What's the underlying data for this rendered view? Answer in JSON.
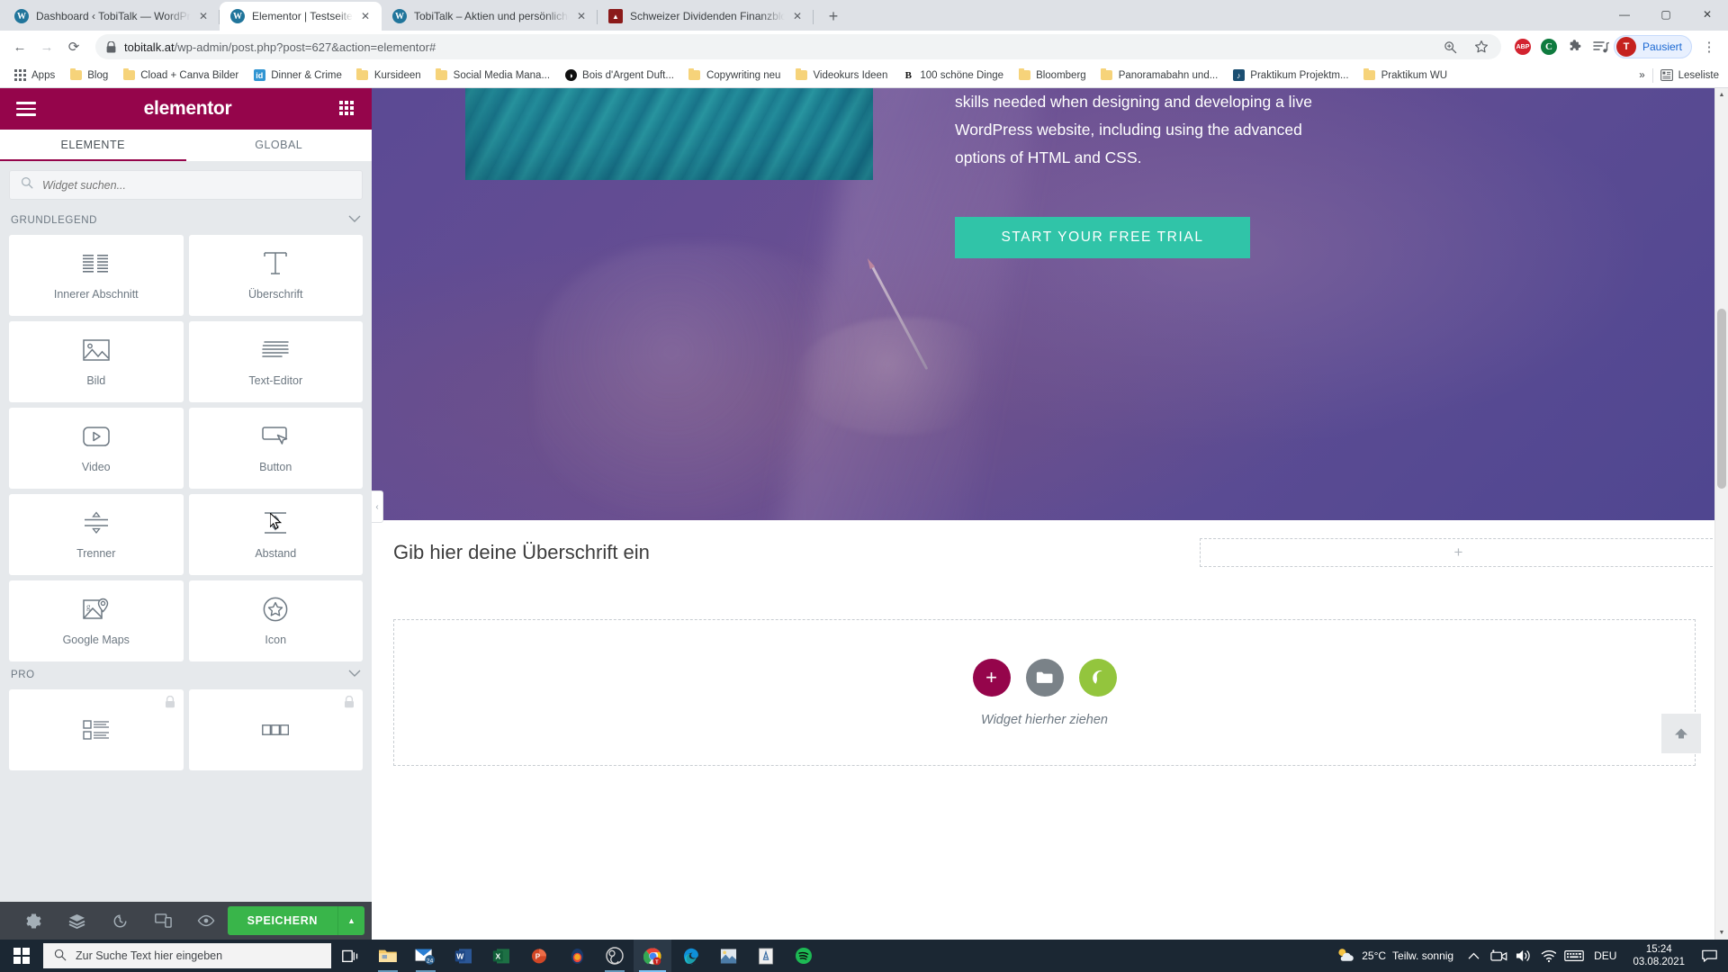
{
  "browser": {
    "tabs": [
      {
        "title": "Dashboard ‹ TobiTalk — WordPre",
        "favicon": "wordpress-icon",
        "active": false
      },
      {
        "title": "Elementor | Testseite",
        "favicon": "wordpress-icon",
        "active": true
      },
      {
        "title": "TobiTalk – Aktien und persönliche",
        "favicon": "wordpress-icon",
        "active": false
      },
      {
        "title": "Schweizer Dividenden Finanzblog",
        "favicon": "site-icon",
        "active": false
      }
    ],
    "new_tab_label": "+",
    "window_controls": {
      "minimize": "—",
      "maximize": "▢",
      "close": "✕"
    },
    "nav": {
      "back": "←",
      "forward": "→",
      "reload": "⟳"
    },
    "omnibox": {
      "host": "tobitalk.at",
      "path": "/wp-admin/post.php?post=627&action=elementor#",
      "lock_icon": "lock-icon",
      "zoom_icon": "zoom-icon",
      "bookmark_icon": "star-icon"
    },
    "extensions": [
      {
        "name": "adblock-plus-icon",
        "label": "ABP"
      },
      {
        "name": "ghostery-icon",
        "label": "C"
      },
      {
        "name": "extensions-puzzle-icon",
        "label": "🧩"
      },
      {
        "name": "reading-list-icon",
        "label": "≡♪"
      }
    ],
    "profile": {
      "initial": "T",
      "label": "Pausiert"
    },
    "menu_icon": "kebab-menu-icon",
    "bookmarks": [
      {
        "label": "Apps",
        "icon": "apps-grid-icon"
      },
      {
        "label": "Blog",
        "icon": "folder-icon"
      },
      {
        "label": "Cload + Canva Bilder",
        "icon": "folder-icon"
      },
      {
        "label": "Dinner & Crime",
        "icon": "id-icon"
      },
      {
        "label": "Kursideen",
        "icon": "folder-icon"
      },
      {
        "label": "Social Media Mana...",
        "icon": "folder-icon"
      },
      {
        "label": "Bois d'Argent Duft...",
        "icon": "dark-circle-icon"
      },
      {
        "label": "Copywriting neu",
        "icon": "folder-icon"
      },
      {
        "label": "Videokurs Ideen",
        "icon": "folder-icon"
      },
      {
        "label": "100 schöne Dinge",
        "icon": "letter-b-icon"
      },
      {
        "label": "Bloomberg",
        "icon": "folder-icon"
      },
      {
        "label": "Panoramabahn und...",
        "icon": "folder-icon"
      },
      {
        "label": "Praktikum Projektm...",
        "icon": "blue-square-icon"
      },
      {
        "label": "Praktikum WU",
        "icon": "folder-icon"
      }
    ],
    "bookmarks_overflow": "»",
    "reading_list": {
      "label": "Leseliste",
      "icon": "reading-list-panel-icon"
    }
  },
  "elementor": {
    "brand": "elementor",
    "menu_icon": "hamburger-menu-icon",
    "grid_icon": "widgets-grid-icon",
    "tabs": [
      {
        "label": "ELEMENTE",
        "active": true
      },
      {
        "label": "GLOBAL",
        "active": false
      }
    ],
    "search": {
      "placeholder": "Widget suchen...",
      "value": "",
      "icon": "search-icon"
    },
    "categories": [
      {
        "name": "GRUNDLEGEND",
        "collapse_icon": "chevron-down-icon",
        "widgets": [
          {
            "label": "Innerer Abschnitt",
            "icon": "inner-section-icon",
            "locked": false
          },
          {
            "label": "Überschrift",
            "icon": "heading-icon",
            "locked": false
          },
          {
            "label": "Bild",
            "icon": "image-icon",
            "locked": false
          },
          {
            "label": "Text-Editor",
            "icon": "text-editor-icon",
            "locked": false
          },
          {
            "label": "Video",
            "icon": "video-icon",
            "locked": false
          },
          {
            "label": "Button",
            "icon": "button-icon",
            "locked": false
          },
          {
            "label": "Trenner",
            "icon": "divider-icon",
            "locked": false
          },
          {
            "label": "Abstand",
            "icon": "spacer-icon",
            "locked": false
          },
          {
            "label": "Google Maps",
            "icon": "google-maps-icon",
            "locked": false
          },
          {
            "label": "Icon",
            "icon": "star-icon",
            "locked": false
          }
        ]
      },
      {
        "name": "PRO",
        "collapse_icon": "chevron-down-icon",
        "widgets": [
          {
            "label": "",
            "icon": "posts-icon",
            "locked": true
          },
          {
            "label": "",
            "icon": "portfolio-icon",
            "locked": true
          }
        ]
      }
    ],
    "footer": {
      "settings_icon": "gear-icon",
      "navigator_icon": "layers-icon",
      "history_icon": "history-icon",
      "responsive_icon": "responsive-mode-icon",
      "preview_icon": "eye-preview-icon",
      "save_label": "SPEICHERN",
      "save_caret": "▲"
    },
    "collapse_arrow": "‹"
  },
  "canvas": {
    "hero": {
      "paragraph": "skills needed when designing and developing a live WordPress website, including using the advanced options of HTML and CSS.",
      "cta_label": "START YOUR FREE TRIAL",
      "cta_color": "#30c4a8"
    },
    "section_heading": "Gib hier deine Überschrift ein",
    "add_section_icon": "+",
    "dropzone": {
      "add_button_icon": "plus-icon",
      "template_button_icon": "folder-icon",
      "elementor_button_icon": "elementor-leaf-icon",
      "label": "Widget hierher ziehen",
      "add_color": "#95054b",
      "template_color": "#7a8288",
      "elementor_color": "#93c53d"
    },
    "back_to_top_icon": "arrow-up-icon"
  },
  "taskbar": {
    "start_icon": "windows-start-icon",
    "search": {
      "placeholder": "Zur Suche Text hier eingeben",
      "icon": "search-icon"
    },
    "task_view_icon": "task-view-icon",
    "apps": [
      {
        "name": "file-explorer-icon",
        "running": true
      },
      {
        "name": "mail-icon",
        "badge": "24",
        "running": true
      },
      {
        "name": "word-icon",
        "running": false
      },
      {
        "name": "excel-icon",
        "running": false
      },
      {
        "name": "powerpoint-icon",
        "running": false
      },
      {
        "name": "sharex-icon",
        "running": false
      },
      {
        "name": "obs-icon",
        "running": true
      },
      {
        "name": "chrome-icon",
        "running": true,
        "active": true
      },
      {
        "name": "edge-icon",
        "running": false
      },
      {
        "name": "photos-icon",
        "running": false
      },
      {
        "name": "reader-icon",
        "running": false
      },
      {
        "name": "spotify-icon",
        "running": false
      }
    ],
    "weather": {
      "temperature": "25°C",
      "condition": "Teilw. sonnig",
      "icon": "partly-sunny-icon"
    },
    "tray": {
      "chevron_icon": "show-hidden-icons-icon",
      "camera_icon": "camera-icon",
      "volume_icon": "volume-icon",
      "network_icon": "wifi-icon",
      "keyboard_icon": "keyboard-icon",
      "language": "DEU"
    },
    "clock": {
      "time": "15:24",
      "date": "03.08.2021"
    },
    "notification_icon": "notification-center-icon"
  }
}
